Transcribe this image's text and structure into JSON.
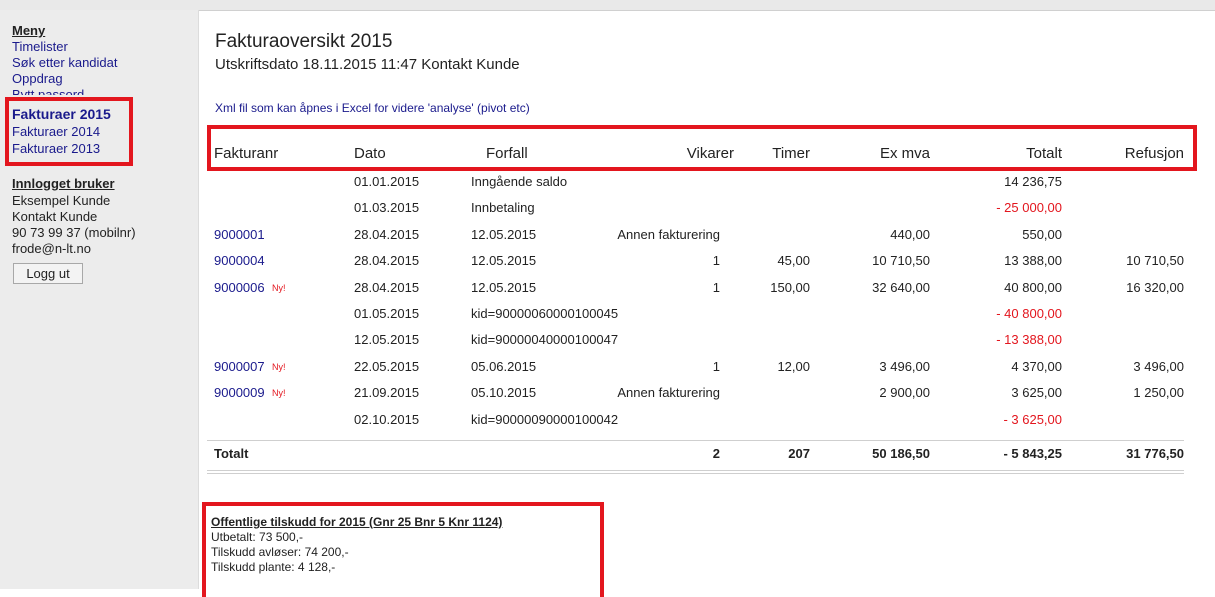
{
  "sidebar": {
    "menu_heading": "Meny",
    "items": [
      "Timelister",
      "Søk etter kandidat",
      "Oppdrag",
      "Bytt passord"
    ],
    "invoice_items": [
      "Fakturaer 2015",
      "Fakturaer 2014",
      "Fakturaer 2013"
    ],
    "user_heading": "Innlogget bruker",
    "user_lines": [
      "Eksempel Kunde",
      "Kontakt Kunde",
      "90 73 99 37 (mobilnr)",
      "frode@n-lt.no"
    ],
    "logout_label": "Logg ut"
  },
  "page": {
    "title": "Fakturaoversikt 2015",
    "subtitle": "Utskriftsdato 18.11.2015 11:47 Kontakt Kunde",
    "xml_link": "Xml fil som kan åpnes i Excel for videre 'analyse' (pivot etc)"
  },
  "table": {
    "headers": [
      "Fakturanr",
      "Dato",
      "Forfall",
      "Vikarer",
      "Timer",
      "Ex mva",
      "Totalt",
      "Refusjon"
    ],
    "rows": [
      {
        "fakturanr": "",
        "ny": "",
        "dato": "01.01.2015",
        "forfall": "Inngående saldo",
        "vikarer": "",
        "timer": "",
        "exmva": "",
        "totalt": "14 236,75",
        "neg": false,
        "refusjon": ""
      },
      {
        "fakturanr": "",
        "ny": "",
        "dato": "01.03.2015",
        "forfall": "Innbetaling",
        "vikarer": "",
        "timer": "",
        "exmva": "",
        "totalt": "- 25 000,00",
        "neg": true,
        "refusjon": ""
      },
      {
        "fakturanr": "9000001",
        "ny": "",
        "dato": "28.04.2015",
        "forfall": "12.05.2015",
        "vikarer": "Annen fakturering",
        "timer": "",
        "exmva": "440,00",
        "totalt": "550,00",
        "neg": false,
        "refusjon": ""
      },
      {
        "fakturanr": "9000004",
        "ny": "",
        "dato": "28.04.2015",
        "forfall": "12.05.2015",
        "vikarer": "1",
        "timer": "45,00",
        "exmva": "10 710,50",
        "totalt": "13 388,00",
        "neg": false,
        "refusjon": "10 710,50"
      },
      {
        "fakturanr": "9000006",
        "ny": "Ny!",
        "dato": "28.04.2015",
        "forfall": "12.05.2015",
        "vikarer": "1",
        "timer": "150,00",
        "exmva": "32 640,00",
        "totalt": "40 800,00",
        "neg": false,
        "refusjon": "16 320,00"
      },
      {
        "fakturanr": "",
        "ny": "",
        "dato": "01.05.2015",
        "forfall": "kid=90000060000100045",
        "vikarer": "",
        "timer": "",
        "exmva": "",
        "totalt": "- 40 800,00",
        "neg": true,
        "refusjon": ""
      },
      {
        "fakturanr": "",
        "ny": "",
        "dato": "12.05.2015",
        "forfall": "kid=90000040000100047",
        "vikarer": "",
        "timer": "",
        "exmva": "",
        "totalt": "- 13 388,00",
        "neg": true,
        "refusjon": ""
      },
      {
        "fakturanr": "9000007",
        "ny": "Ny!",
        "dato": "22.05.2015",
        "forfall": "05.06.2015",
        "vikarer": "1",
        "timer": "12,00",
        "exmva": "3 496,00",
        "totalt": "4 370,00",
        "neg": false,
        "refusjon": "3 496,00"
      },
      {
        "fakturanr": "9000009",
        "ny": "Ny!",
        "dato": "21.09.2015",
        "forfall": "05.10.2015",
        "vikarer": "Annen fakturering",
        "timer": "",
        "exmva": "2 900,00",
        "totalt": "3 625,00",
        "neg": false,
        "refusjon": "1 250,00"
      },
      {
        "fakturanr": "",
        "ny": "",
        "dato": "02.10.2015",
        "forfall": "kid=90000090000100042",
        "vikarer": "",
        "timer": "",
        "exmva": "",
        "totalt": "- 3 625,00",
        "neg": true,
        "refusjon": ""
      }
    ],
    "totals": {
      "label": "Totalt",
      "vikarer": "2",
      "timer": "207",
      "exmva": "50 186,50",
      "totalt": "- 5 843,25",
      "refusjon": "31 776,50"
    }
  },
  "subsidy": {
    "title": "Offentlige tilskudd for 2015 (Gnr 25 Bnr 5 Knr 1124)",
    "lines": [
      "Utbetalt: 73 500,-",
      "Tilskudd avløser: 74 200,-",
      "Tilskudd plante: 4 128,-"
    ]
  },
  "colors": {
    "highlight": "#e3161e",
    "link": "#1a1a8c"
  }
}
